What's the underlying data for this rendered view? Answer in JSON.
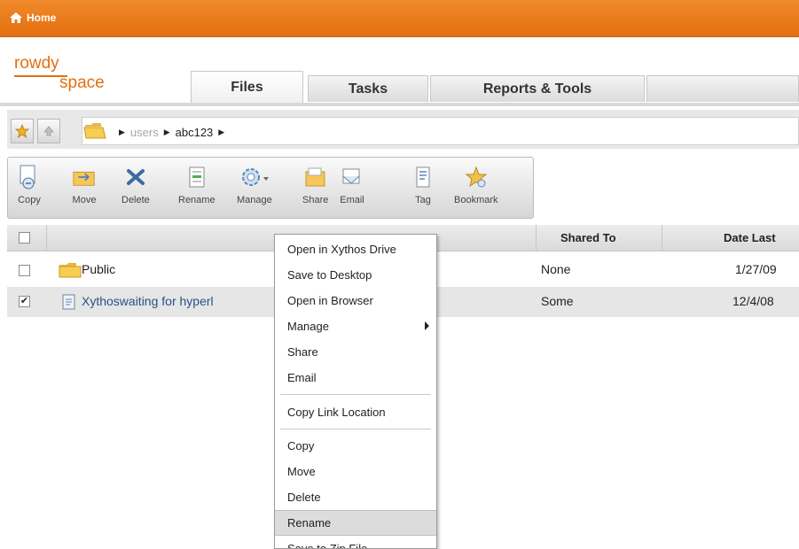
{
  "header": {
    "home_label": "Home"
  },
  "logo": {
    "line1": "rowdy",
    "line2": "space"
  },
  "tabs": [
    {
      "label": "Files",
      "active": true
    },
    {
      "label": "Tasks",
      "active": false
    },
    {
      "label": "Reports & Tools",
      "active": false
    }
  ],
  "breadcrumb": {
    "items": [
      "users",
      "abc123"
    ]
  },
  "toolbar": {
    "buttons": [
      {
        "label": "Copy",
        "icon": "copy-icon"
      },
      {
        "label": "Move",
        "icon": "move-icon"
      },
      {
        "label": "Delete",
        "icon": "delete-icon"
      },
      {
        "label": "Rename",
        "icon": "rename-icon"
      },
      {
        "label": "Manage",
        "icon": "gear-icon"
      },
      {
        "label": "Share",
        "icon": "share-icon"
      },
      {
        "label": "Email",
        "icon": "email-icon"
      },
      {
        "label": "Tag",
        "icon": "tag-icon"
      },
      {
        "label": "Bookmark",
        "icon": "bookmark-star-icon"
      }
    ]
  },
  "table": {
    "columns": {
      "shared_to": "Shared To",
      "date_last": "Date Last"
    },
    "rows": [
      {
        "name": "Public",
        "checked": false,
        "shared_to": "None",
        "date": "1/27/09",
        "icon": "folder-icon"
      },
      {
        "name": "Xythoswaiting for hyperl",
        "checked": true,
        "shared_to": "Some",
        "date": "12/4/08",
        "icon": "document-icon"
      }
    ]
  },
  "context_menu": {
    "items": [
      {
        "label": "Open in Xythos Drive"
      },
      {
        "label": "Save to Desktop"
      },
      {
        "label": "Open in Browser"
      },
      {
        "label": "Manage",
        "submenu": true
      },
      {
        "label": "Share"
      },
      {
        "label": "Email"
      },
      {
        "label": "Copy Link Location"
      },
      {
        "label": "Copy"
      },
      {
        "label": "Move"
      },
      {
        "label": "Delete"
      },
      {
        "label": "Rename",
        "highlighted": true
      },
      {
        "label": "Save to Zip File"
      }
    ]
  },
  "colors": {
    "accent": "#e46f10",
    "selection": "#e6e6e6"
  }
}
